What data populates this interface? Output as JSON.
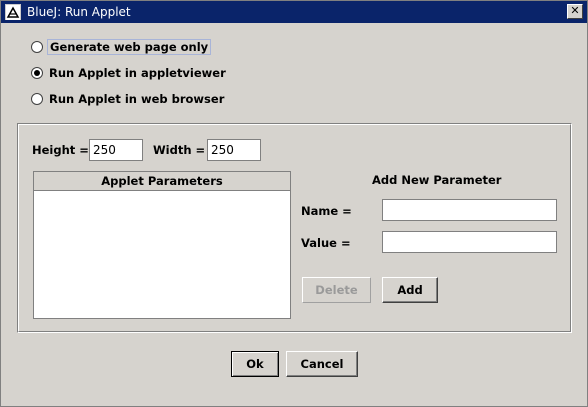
{
  "window": {
    "title": "BlueJ:  Run Applet",
    "close_glyph": "✕"
  },
  "options": [
    {
      "label": "Generate web page only",
      "checked": false,
      "focused": true
    },
    {
      "label": "Run Applet in appletviewer",
      "checked": true,
      "focused": false
    },
    {
      "label": "Run Applet in web browser",
      "checked": false,
      "focused": false
    }
  ],
  "size": {
    "height_label": "Height =",
    "height_value": "250",
    "width_label": "Width =",
    "width_value": "250"
  },
  "params": {
    "header": "Applet Parameters",
    "rows": []
  },
  "new_param": {
    "heading": "Add New Parameter",
    "name_label": "Name =",
    "name_value": "",
    "value_label": "Value =",
    "value_value": ""
  },
  "buttons": {
    "delete": "Delete",
    "add": "Add",
    "ok": "Ok",
    "cancel": "Cancel"
  }
}
